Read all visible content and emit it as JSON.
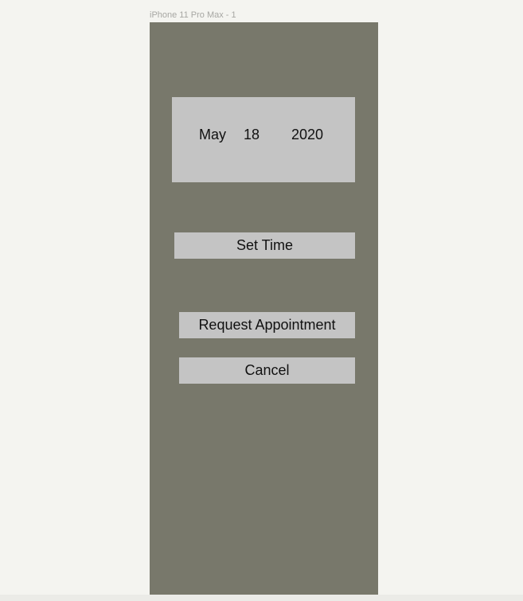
{
  "canvas": {
    "frame_label": "iPhone 11 Pro Max - 1"
  },
  "date_picker": {
    "month": "May",
    "day": "18",
    "year": "2020"
  },
  "buttons": {
    "set_time": "Set Time",
    "request_appointment": "Request Appointment",
    "cancel": "Cancel"
  },
  "colors": {
    "canvas_background": "#f4f4f0",
    "frame_background": "#78786b",
    "control_background": "#c4c4c4",
    "text": "#111111"
  }
}
